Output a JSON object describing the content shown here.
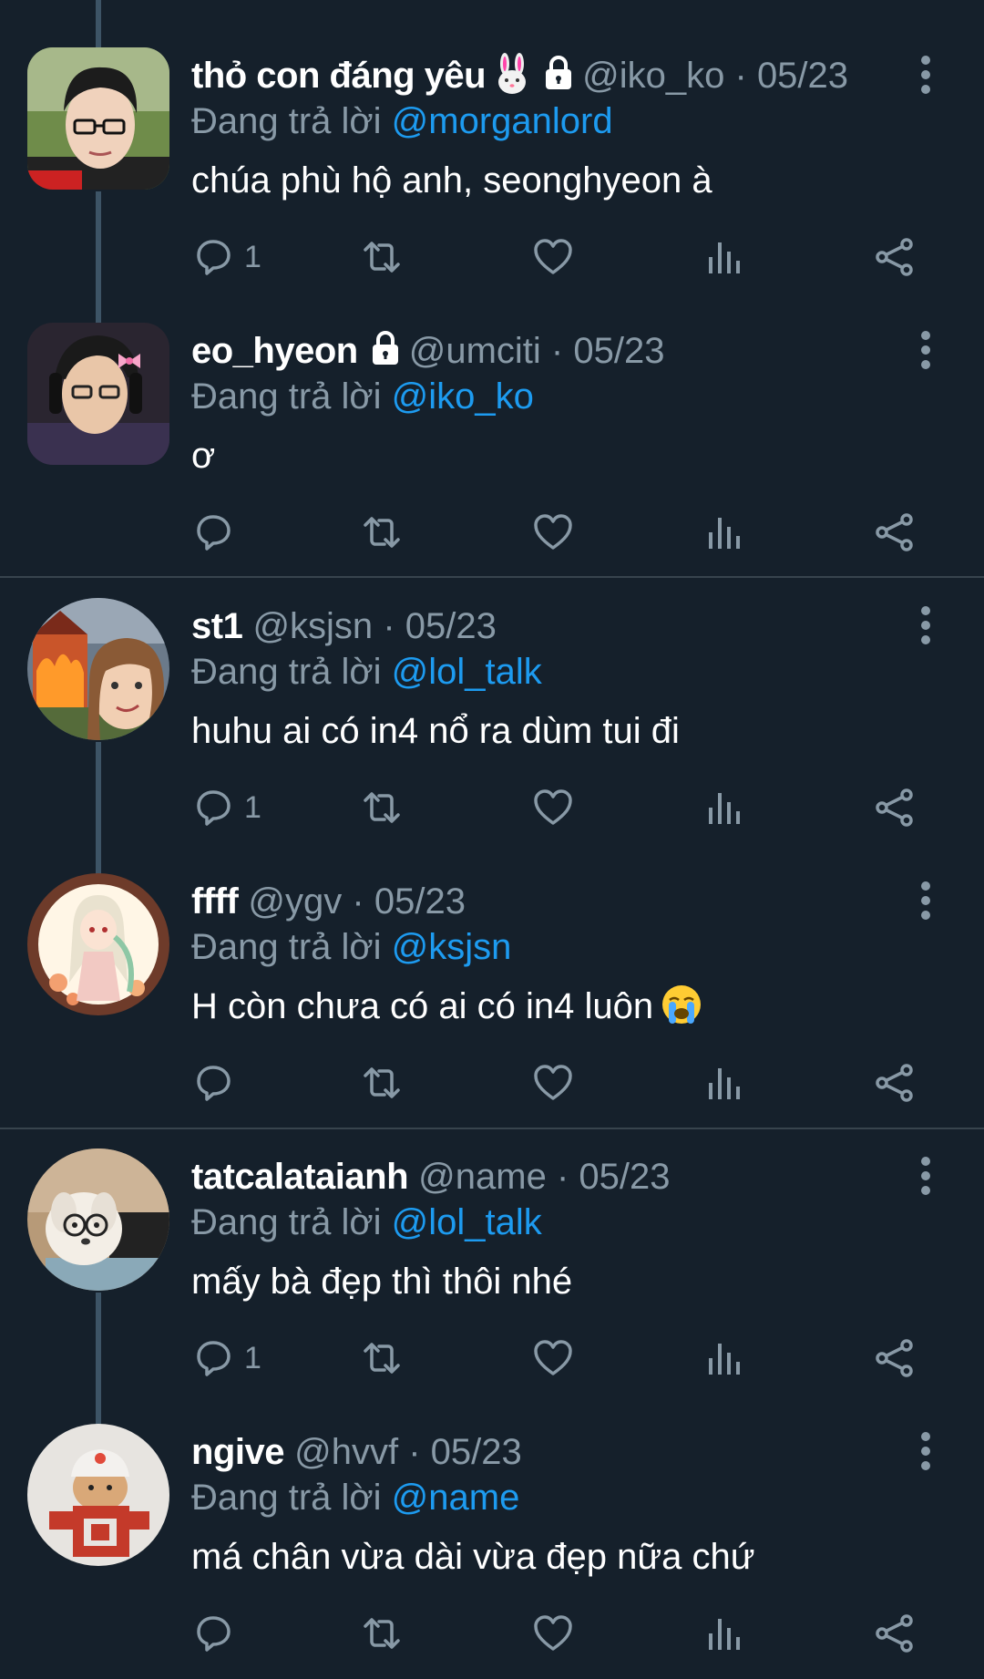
{
  "reply_prefix": "Đang trả lời",
  "separator": "·",
  "tweets": [
    {
      "name": "thỏ con đáng yêu",
      "has_rabbit_emoji": true,
      "locked": true,
      "handle": "@iko_ko",
      "date": "05/23",
      "reply_to": "@morganlord",
      "text": "chúa phù hộ anh, seonghyeon à",
      "reply_count": "1"
    },
    {
      "name": "eo_hyeon",
      "locked": true,
      "handle": "@umciti",
      "date": "05/23",
      "reply_to": "@iko_ko",
      "text": "ơ",
      "reply_count": ""
    },
    {
      "name": "st1",
      "locked": false,
      "handle": "@ksjsn",
      "date": "05/23",
      "reply_to": "@lol_talk",
      "text": "huhu ai có in4 nổ ra dùm tui đi",
      "reply_count": "1"
    },
    {
      "name": "ffff",
      "locked": false,
      "handle": "@ygv",
      "date": "05/23",
      "reply_to": "@ksjsn",
      "text": "H còn chưa có ai có in4 luôn",
      "has_cry_emoji": true,
      "reply_count": ""
    },
    {
      "name": "tatcalataianh",
      "locked": false,
      "handle": "@name",
      "date": "05/23",
      "reply_to": "@lol_talk",
      "text": "mấy bà đẹp thì thôi nhé",
      "reply_count": "1"
    },
    {
      "name": "ngive",
      "locked": false,
      "handle": "@hvvf",
      "date": "05/23",
      "reply_to": "@name",
      "text": "má chân vừa dài vừa đẹp nữa chứ",
      "reply_count": ""
    }
  ],
  "icons": {
    "reply": "reply-icon",
    "retweet": "retweet-icon",
    "like": "heart-icon",
    "views": "views-icon",
    "share": "share-icon",
    "more": "more-vertical-icon",
    "lock": "lock-icon"
  },
  "colors": {
    "background": "#15202b",
    "secondary_text": "#8899a6",
    "mention": "#1d9bf0",
    "divider": "#38444d"
  }
}
